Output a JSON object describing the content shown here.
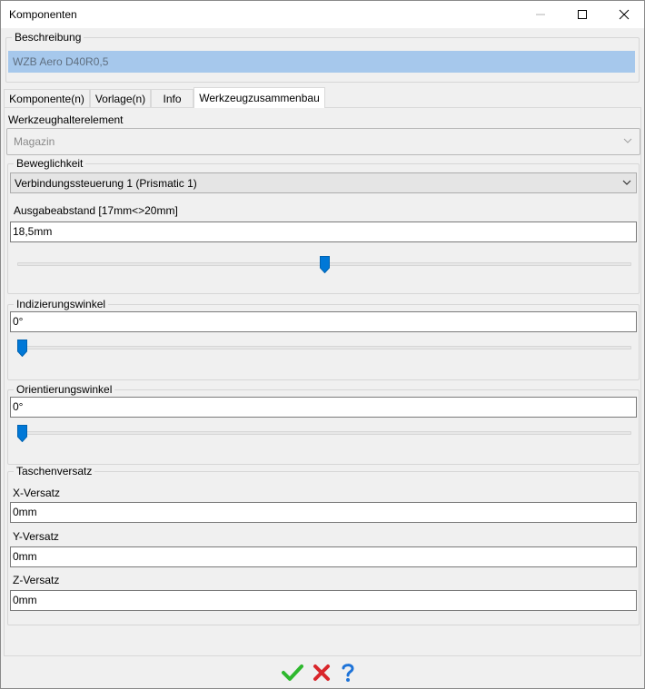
{
  "window": {
    "title": "Komponenten"
  },
  "beschreibung": {
    "label": "Beschreibung",
    "value": "WZB Aero D40R0,5"
  },
  "tabs": [
    {
      "label": "Komponente(n)",
      "active": false
    },
    {
      "label": "Vorlage(n)",
      "active": false
    },
    {
      "label": "Info",
      "active": false
    },
    {
      "label": "Werkzeugzusammenbau",
      "active": true
    }
  ],
  "holder": {
    "label": "Werkzeughalterelement",
    "value": "Magazin"
  },
  "beweglichkeit": {
    "label": "Beweglichkeit",
    "combo_value": "Verbindungssteuerung 1 (Prismatic 1)",
    "range_label": "Ausgabeabstand  [17mm<>20mm]",
    "value": "18,5mm",
    "slider_fraction": 0.5
  },
  "indizierung": {
    "label": "Indizierungswinkel",
    "value": "0°",
    "slider_fraction": 0.0
  },
  "orientierung": {
    "label": "Orientierungswinkel",
    "value": "0°",
    "slider_fraction": 0.0
  },
  "taschenversatz": {
    "label": "Taschenversatz",
    "x_label": "X-Versatz",
    "x_value": "0mm",
    "y_label": "Y-Versatz",
    "y_value": "0mm",
    "z_label": "Z-Versatz",
    "z_value": "0mm"
  },
  "colors": {
    "accent": "#0078d7",
    "selection": "#a6c8ec",
    "ok": "#2eb82e",
    "cancel": "#d9262b",
    "help": "#1e73d8"
  },
  "icons": {
    "ok": "check-icon",
    "cancel": "cross-icon",
    "help": "question-icon"
  }
}
